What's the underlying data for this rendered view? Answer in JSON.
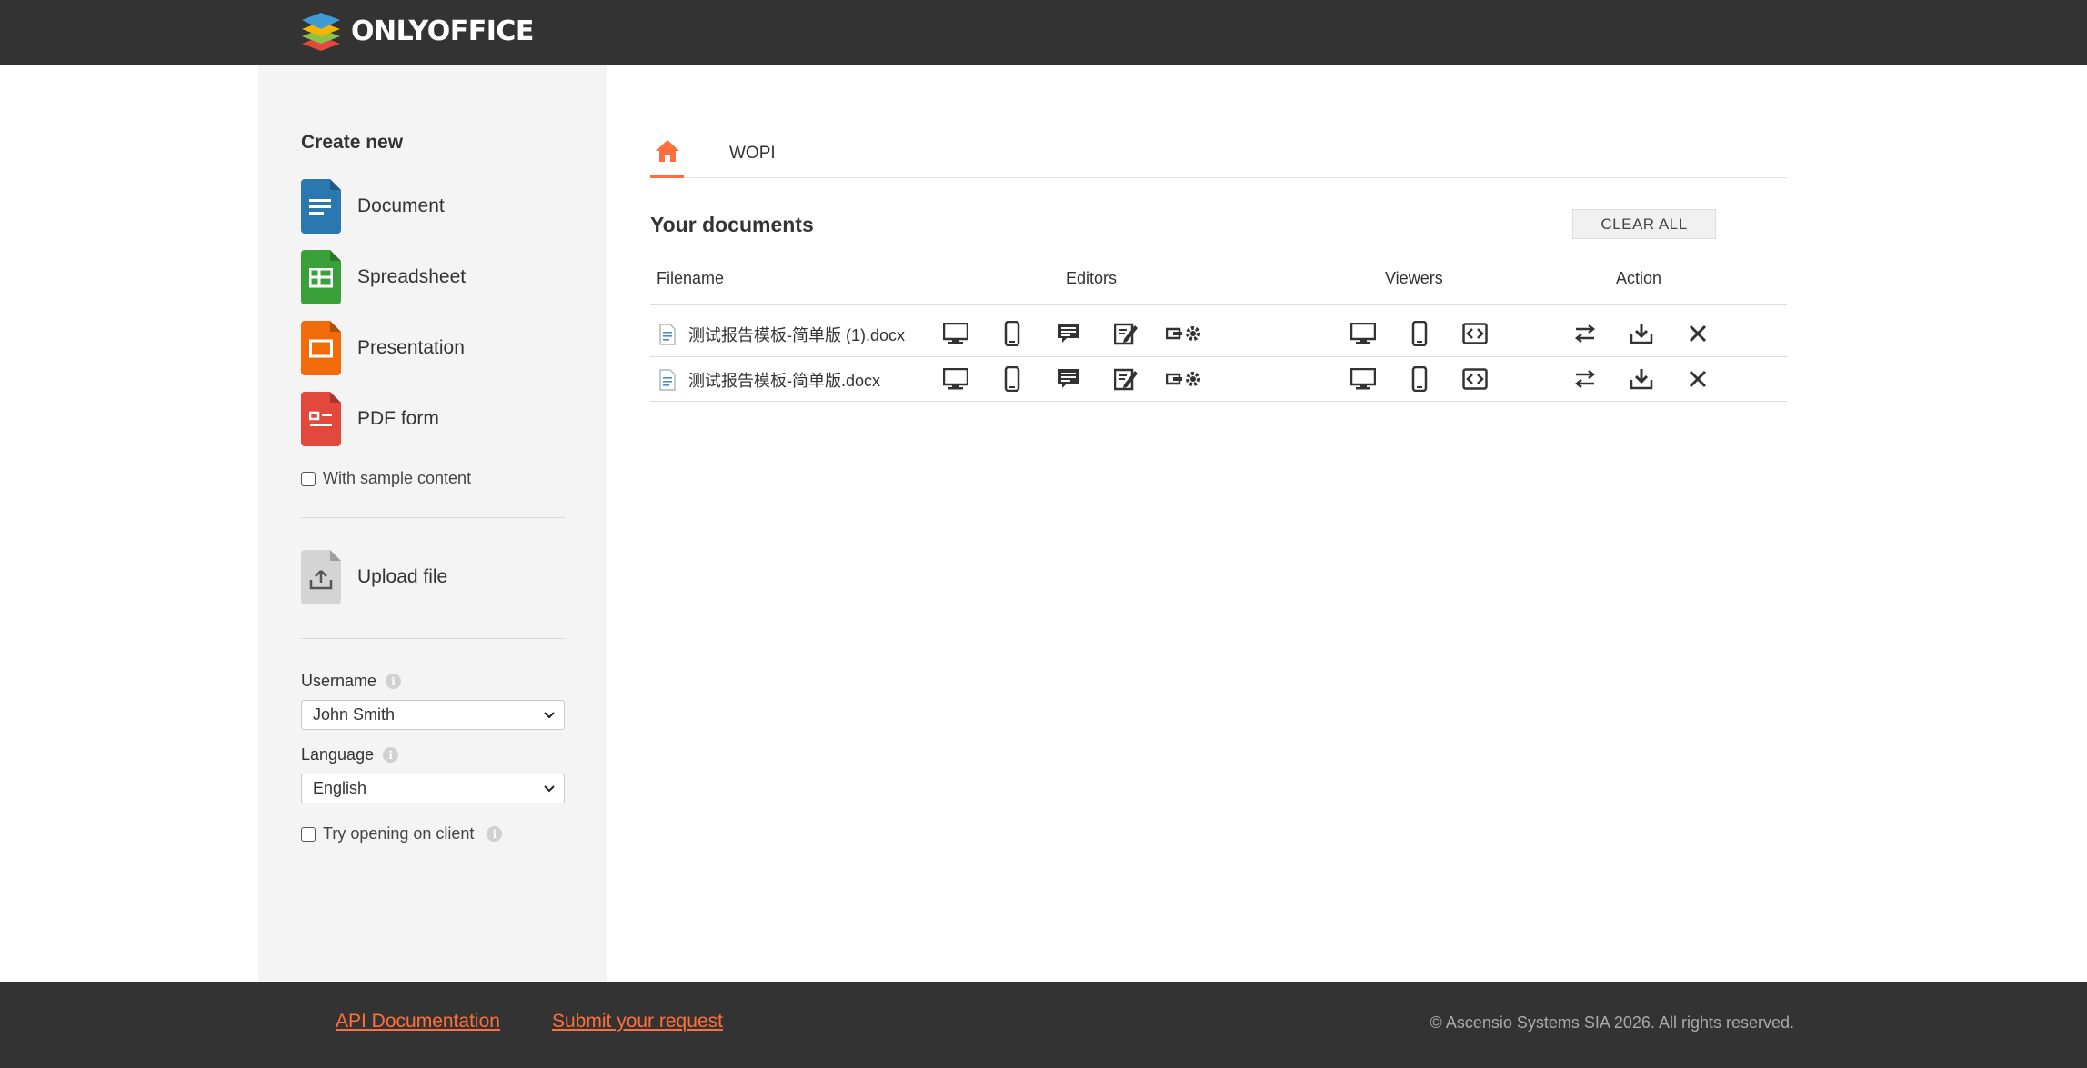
{
  "header": {
    "logo_text": "ONLYOFFICE"
  },
  "sidebar": {
    "create_title": "Create new",
    "create_items": [
      {
        "label": "Document",
        "color": "#2b77b0",
        "icon": "document-icon"
      },
      {
        "label": "Spreadsheet",
        "color": "#3aa13a",
        "icon": "spreadsheet-icon"
      },
      {
        "label": "Presentation",
        "color": "#f16b0a",
        "icon": "presentation-icon"
      },
      {
        "label": "PDF form",
        "color": "#e2493c",
        "icon": "pdf-form-icon"
      }
    ],
    "sample_content_label": "With sample content",
    "upload_label": "Upload file",
    "username_label": "Username",
    "username_value": "John Smith",
    "language_label": "Language",
    "language_value": "English",
    "try_client_label": "Try opening on client"
  },
  "tabs": {
    "wopi": "WOPI"
  },
  "main": {
    "title": "Your documents",
    "clear_all": "CLEAR ALL",
    "columns": {
      "filename": "Filename",
      "editors": "Editors",
      "viewers": "Viewers",
      "action": "Action"
    },
    "documents": [
      {
        "filename": "测试报告模板-简单版 (1).docx"
      },
      {
        "filename": "测试报告模板-简单版.docx"
      }
    ]
  },
  "footer": {
    "api_docs": "API Documentation",
    "submit_request": "Submit your request",
    "copyright": "© Ascensio Systems SIA 2026. All rights reserved."
  },
  "colors": {
    "accent": "#ff6f3d",
    "topbar": "#333333",
    "sidebar_bg": "#f4f4f4"
  }
}
